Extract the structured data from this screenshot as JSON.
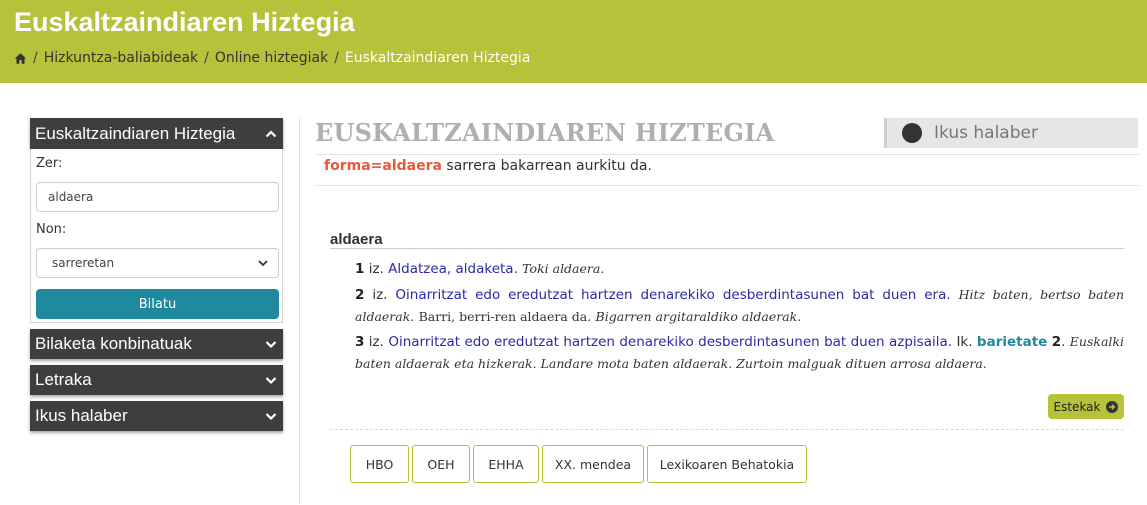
{
  "header": {
    "title": "Euskaltzaindiaren Hiztegia",
    "breadcrumb": {
      "separator": "/",
      "items": [
        "Hizkuntza-baliabideak",
        "Online hiztegiak"
      ],
      "current": "Euskaltzaindiaren Hiztegia"
    }
  },
  "sidebar": {
    "search_panel": {
      "title": "Euskaltzaindiaren Hiztegia",
      "what_label": "Zer:",
      "what_value": "aldaera",
      "where_label": "Non:",
      "where_value": "sarreretan",
      "submit_label": "Bilatu"
    },
    "panels": [
      "Bilaketa konbinatuak",
      "Letraka",
      "Ikus halaber"
    ]
  },
  "main": {
    "title": "EUSKALTZAINDIAREN HIZTEGIA",
    "see_also": "Ikus halaber",
    "result": {
      "query": "forma=aldaera",
      "message": "sarrera bakarrean aurkitu da."
    },
    "entry": {
      "headword": "aldaera",
      "senses": [
        {
          "number": "1",
          "pos": "iz.",
          "definition": "Aldatzea, aldaketa.",
          "examples": "Toki aldaera."
        },
        {
          "number": "2",
          "pos": "iz.",
          "definition": "Oinarritzat edo eredutzat hartzen denarekiko desberdintasunen bat duen era.",
          "examples_1": "Hitz baten, bertso baten aldaerak.",
          "plain": "Barri, berri-ren aldaera da.",
          "examples_2": "Bigarren argitaraldiko aldaerak."
        },
        {
          "number": "3",
          "pos": "iz.",
          "definition": "Oinarritzat edo eredutzat hartzen denarekiko desberdintasunen bat duen azpisaila.",
          "see": "Ik.",
          "xref_word": "barietate",
          "xref_num": "2",
          "examples": "Euskalki baten aldaerak eta hizkerak. Landare mota baten aldaerak. Zurtoin malguak dituen arrosa aldaera."
        }
      ]
    },
    "sources_label": "Estekak",
    "dictionary_links": [
      "HBO",
      "OEH",
      "EHHA",
      "XX. mendea",
      "Lexikoaren Behatokia"
    ]
  },
  "colors": {
    "brand": "#b5c23a",
    "panel_dark": "#403d3e",
    "button_teal": "#1f8a9d",
    "definition_blue": "#2a2aa8",
    "query_red": "#e8593a"
  }
}
